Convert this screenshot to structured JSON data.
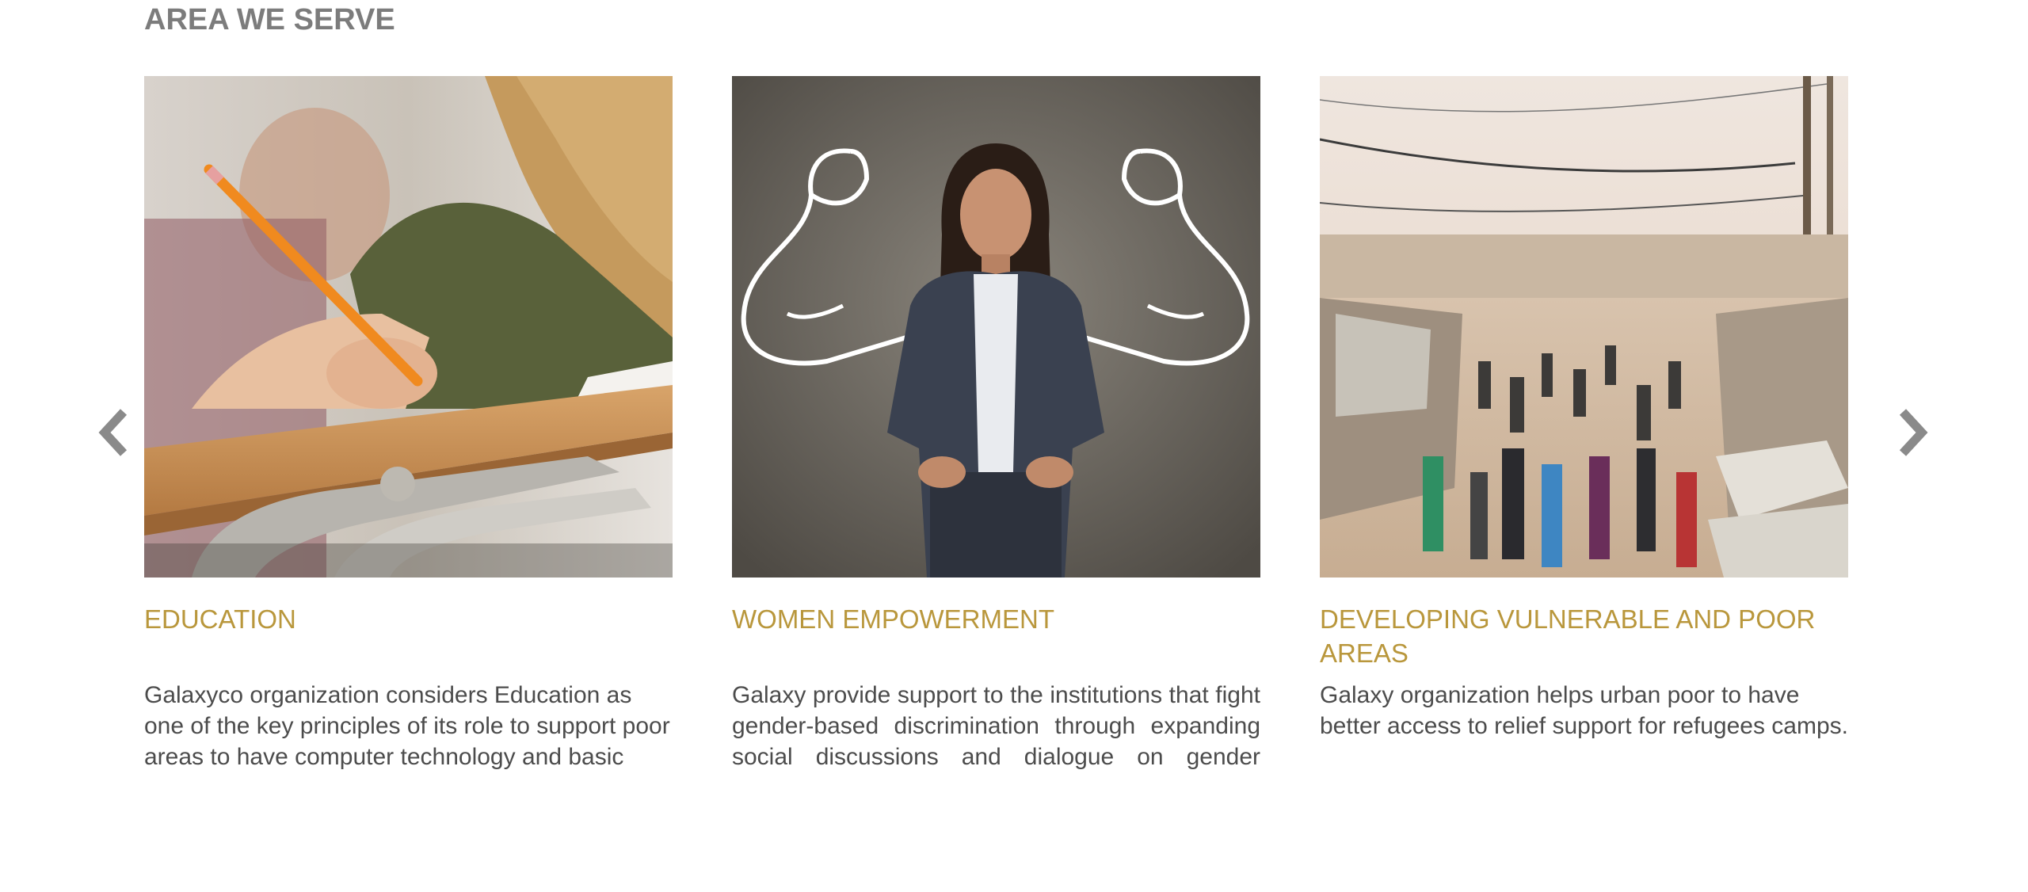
{
  "section": {
    "title": "AREA WE SERVE"
  },
  "carousel": {
    "prev_icon": "chevron-left-icon",
    "next_icon": "chevron-right-icon",
    "arrow_color": "#8a8a8a"
  },
  "cards": [
    {
      "title": "EDUCATION",
      "body": "Galaxyco organization considers Education as one of the key principles of its role to support poor areas to have computer technology and basic computer skills.",
      "image": "student-writing-with-pencil-photo"
    },
    {
      "title": "WOMEN EMPOWERMENT",
      "body": "Galaxy provide support to the institutions that fight gender-based discrimination through expanding social discussions and dialogue on gender equality and the rights of women and girls.",
      "image": "businesswoman-with-drawn-strong-arms-photo"
    },
    {
      "title": "DEVELOPING VULNERABLE AND POOR AREAS",
      "body": "Galaxy organization helps urban poor to have better access to relief support for refugees camps.",
      "image": "refugee-camp-street-photo"
    }
  ],
  "colors": {
    "title_gray": "#7c7c7c",
    "accent_gold": "#b9973c",
    "body_text": "#4c4c4c"
  }
}
